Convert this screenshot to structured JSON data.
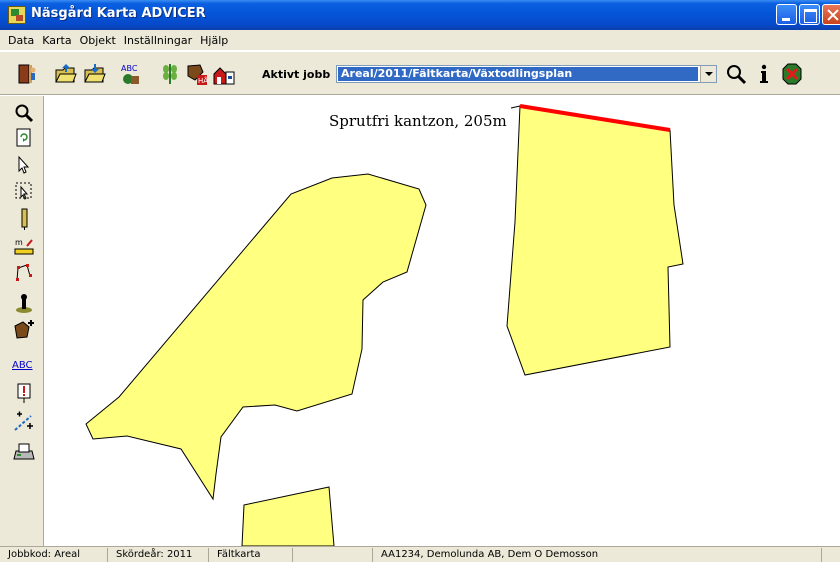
{
  "window": {
    "title": "Näsgård Karta ADVICER"
  },
  "menu": {
    "items": [
      "Data",
      "Karta",
      "Objekt",
      "Inställningar",
      "Hjälp"
    ]
  },
  "toolbar": {
    "active_job_label": "Aktivt jobb",
    "active_job_value": "Areal/2011/Fältkarta/Växtodlingsplan",
    "icons": [
      "exit-icon",
      "open-folder-icon",
      "save-folder-icon",
      "abc-label-icon",
      "crop-icon",
      "field-map-icon",
      "farm-icon",
      "search-icon",
      "info-icon",
      "stop-icon"
    ]
  },
  "left_tools": {
    "icons": [
      "zoom-icon",
      "refresh-icon",
      "pointer-icon",
      "select-area-icon",
      "ruler-icon",
      "measure-icon",
      "polygon-edit-icon",
      "marker-icon",
      "add-field-icon",
      "abc-text-icon",
      "warning-marker-icon",
      "add-line-icon",
      "print-icon"
    ],
    "abc_label": "ABC"
  },
  "map": {
    "annotation": "Sprutfri kantzon, 205m",
    "field_color": "#ffff80",
    "buffer_color": "#ff0000"
  },
  "statusbar": {
    "job_code": "Jobbkod: Areal",
    "harvest_year": "Skördeår: 2011",
    "map_type": "Fältkarta",
    "empty": "",
    "customer": "AA1234, Demolunda AB, Dem O Demosson"
  }
}
